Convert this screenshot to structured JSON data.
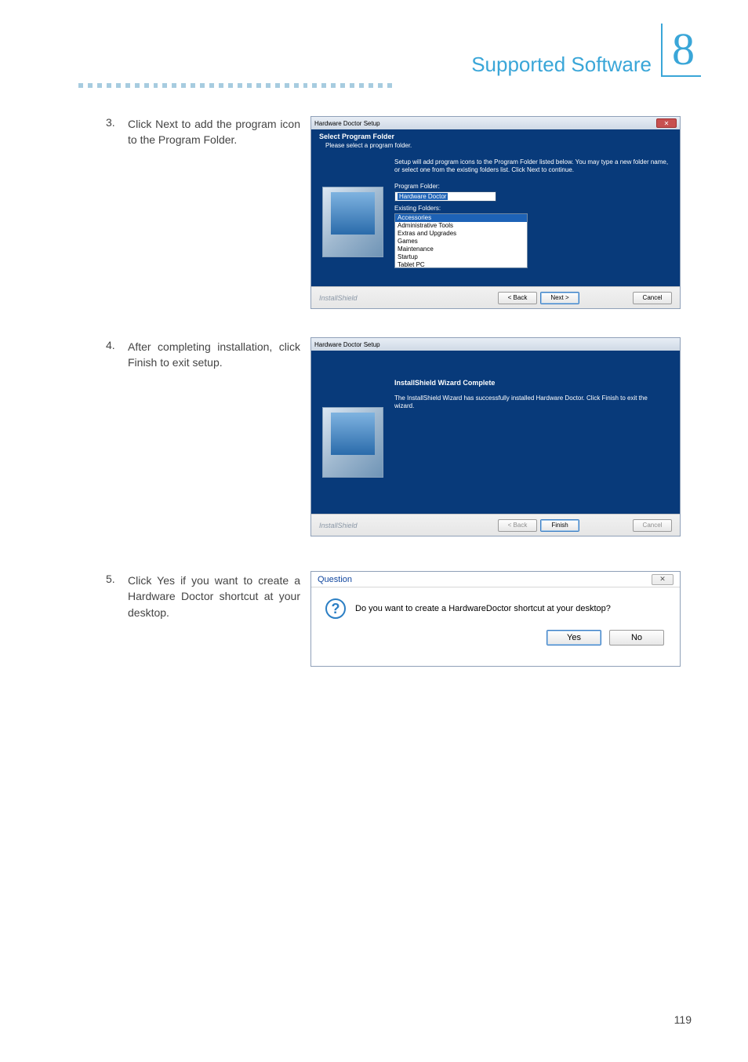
{
  "header": {
    "chapter_number": "8",
    "chapter_title": "Supported Software"
  },
  "steps": [
    {
      "num": "3.",
      "text": "Click Next to add the pro­gram icon to the Program Folder."
    },
    {
      "num": "4.",
      "text": "After completing instal­lation, click Finish to exit setup."
    },
    {
      "num": "5.",
      "text": "Click Yes if you want to create a Hardware Doctor shortcut at your desktop."
    }
  ],
  "shot1": {
    "title": "Hardware Doctor Setup",
    "heading": "Select Program Folder",
    "subheading": "Please select a program folder.",
    "help": "Setup will add program icons to the Program Folder listed below. You may type a new folder name, or select one from the existing folders list.  Click Next to continue.",
    "pf_label": "Program Folder:",
    "pf_value": "Hardware Doctor",
    "ef_label": "Existing Folders:",
    "existing": [
      "Accessories",
      "Administrative Tools",
      "Extras and Upgrades",
      "Games",
      "Maintenance",
      "Startup",
      "Tablet PC"
    ],
    "brand": "InstallShield",
    "back": "< Back",
    "next": "Next >",
    "cancel": "Cancel"
  },
  "shot2": {
    "title": "Hardware Doctor Setup",
    "heading": "InstallShield Wizard Complete",
    "help": "The InstallShield Wizard has successfully installed Hardware Doctor. Click Finish to exit the wizard.",
    "brand": "InstallShield",
    "back": "< Back",
    "finish": "Finish",
    "cancel": "Cancel"
  },
  "shot3": {
    "title": "Question",
    "text": "Do you want to create a HardwareDoctor shortcut at your desktop?",
    "yes": "Yes",
    "no": "No"
  },
  "page_number": "119"
}
